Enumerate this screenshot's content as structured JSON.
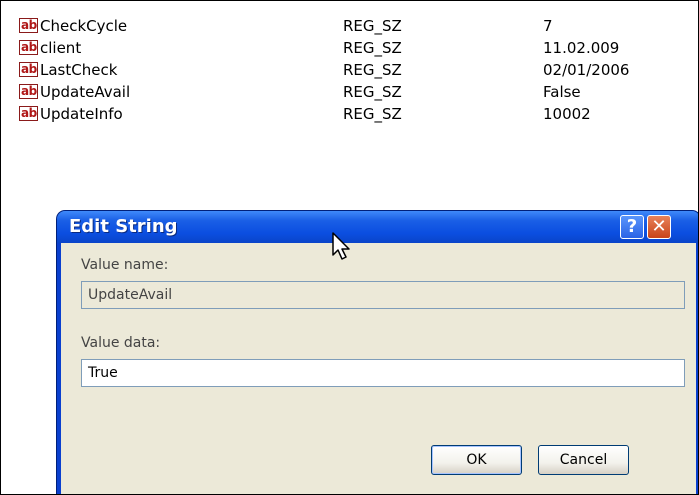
{
  "registry": {
    "rows": [
      {
        "name": "CheckCycle",
        "type": "REG_SZ",
        "data": "7"
      },
      {
        "name": "client",
        "type": "REG_SZ",
        "data": "11.02.009"
      },
      {
        "name": "LastCheck",
        "type": "REG_SZ",
        "data": "02/01/2006"
      },
      {
        "name": "UpdateAvail",
        "type": "REG_SZ",
        "data": "False"
      },
      {
        "name": "UpdateInfo",
        "type": "REG_SZ",
        "data": "10002"
      }
    ],
    "icon_glyph": "ab"
  },
  "dialog": {
    "title": "Edit String",
    "help_glyph": "?",
    "close_glyph": "✕",
    "value_name_label": "Value name:",
    "value_name": "UpdateAvail",
    "value_data_label": "Value data:",
    "value_data": "True",
    "ok_label": "OK",
    "cancel_label": "Cancel"
  },
  "colors": {
    "titlebar": "#0b4ee0",
    "dialog_body": "#ece9d8",
    "reg_icon": "#b01818"
  },
  "icons": [
    "string-value-icon",
    "help-icon",
    "close-icon",
    "mouse-cursor-icon"
  ]
}
